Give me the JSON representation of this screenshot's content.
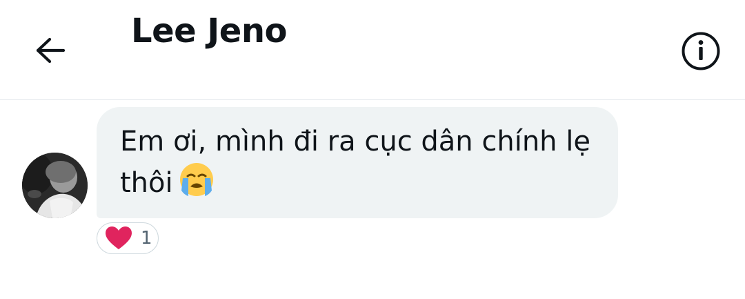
{
  "header": {
    "title": "Lee Jeno",
    "back_icon": "arrow-left-icon",
    "info_icon": "info-circle-icon"
  },
  "message": {
    "text": "Em ơi, mình đi ra cục dân chính lẹ\nthôi",
    "emoji": "loudly-crying-face-icon"
  },
  "reaction": {
    "icon": "heart-icon",
    "count": "1"
  },
  "colors": {
    "bubble": "#eff3f4",
    "text": "#0f1419",
    "heart": "#e0245e",
    "divider": "#e3e8ec"
  }
}
